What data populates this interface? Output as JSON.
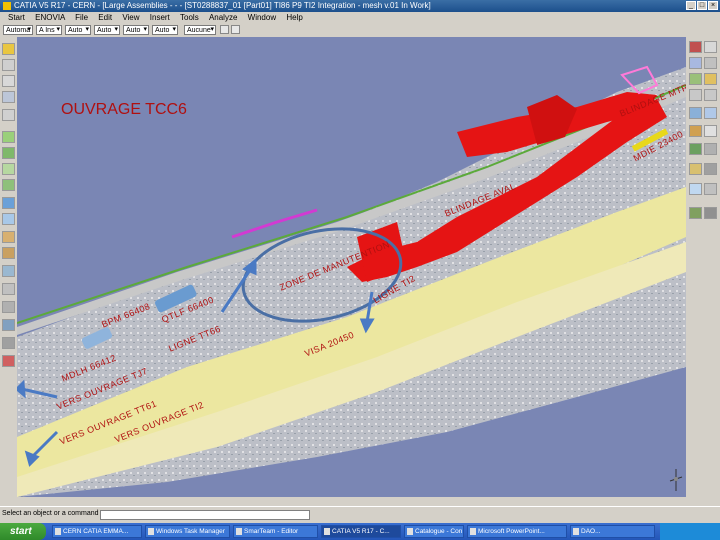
{
  "window": {
    "title": "CATIA V5 R17 - CERN - [Large Assemblies - - - [ST0288837_01 [Part01] TI86 P9 TI2 Integration - mesh v.01 In Work]",
    "controls": [
      "_",
      "□",
      "×"
    ]
  },
  "menu": [
    "Start",
    "ENOVIA",
    "File",
    "Edit",
    "View",
    "Insert",
    "Tools",
    "Analyze",
    "Window",
    "Help"
  ],
  "toolbar": {
    "selects": [
      "Automa",
      "A Ins",
      "Auto",
      "Auto",
      "Auto",
      "Auto",
      "Aucune"
    ]
  },
  "viewport": {
    "title": "OUVRAGE TCC6",
    "labels": [
      "BLINDAGE MTR",
      "MDIE 23400",
      "BLINDAGE AVAL",
      "ZONE DE MANUTENTION",
      "LIGNE TI2",
      "BPM 66408",
      "QTLF 66400",
      "LIGNE TT66",
      "VISA 20450",
      "MDLH 66412",
      "VERS OUVRAGE TJ7",
      "VERS OUVRAGE TT61",
      "VERS OUVRAGE TI2"
    ],
    "colors": {
      "background": "#7a86b4",
      "structure": "#e51414",
      "tunnel_floor": "#ece7a0",
      "label": "#b01010",
      "circle": "#4a6fa5",
      "arrow": "#4a7ac4"
    }
  },
  "commandbar": {
    "prompt": "Select an object or a command"
  },
  "taskbar": {
    "start": "start",
    "tasks": [
      "CERN CATIA EMMA...",
      "Windows Task Manager",
      "SmarTeam - Editor",
      "CATIA V5 R17 - C...",
      "Catalogue - Con...",
      "Microsoft PowerPoint...",
      "DAO..."
    ]
  }
}
